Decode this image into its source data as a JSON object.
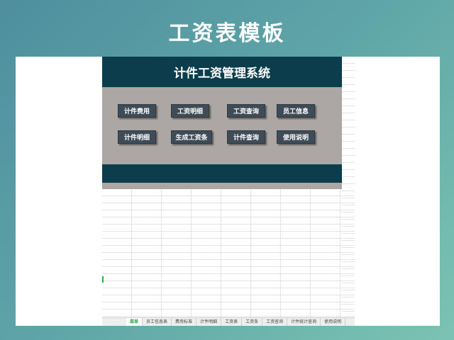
{
  "banner": {
    "title": "工资表模板"
  },
  "panel": {
    "title": "计件工资管理系统",
    "buttons": [
      {
        "label": "计件费用"
      },
      {
        "label": "工资明细"
      },
      {
        "label": "工资查询"
      },
      {
        "label": "员工信息"
      },
      {
        "label": "计件明细"
      },
      {
        "label": "生成工资条"
      },
      {
        "label": "计件查询"
      },
      {
        "label": "使用说明"
      }
    ]
  },
  "tabs": [
    {
      "label": "菜单",
      "active": true
    },
    {
      "label": "员工信息表"
    },
    {
      "label": "费用标准"
    },
    {
      "label": "计件明细"
    },
    {
      "label": "工资表"
    },
    {
      "label": "工资条"
    },
    {
      "label": "工资查询"
    },
    {
      "label": "计件统计查询"
    },
    {
      "label": "使用说明"
    }
  ],
  "colors": {
    "panel_dark": "#0c3d4c",
    "panel_gray": "#aca7a4",
    "button": "#3f4b57",
    "active_tab": "#1e9e3c"
  }
}
